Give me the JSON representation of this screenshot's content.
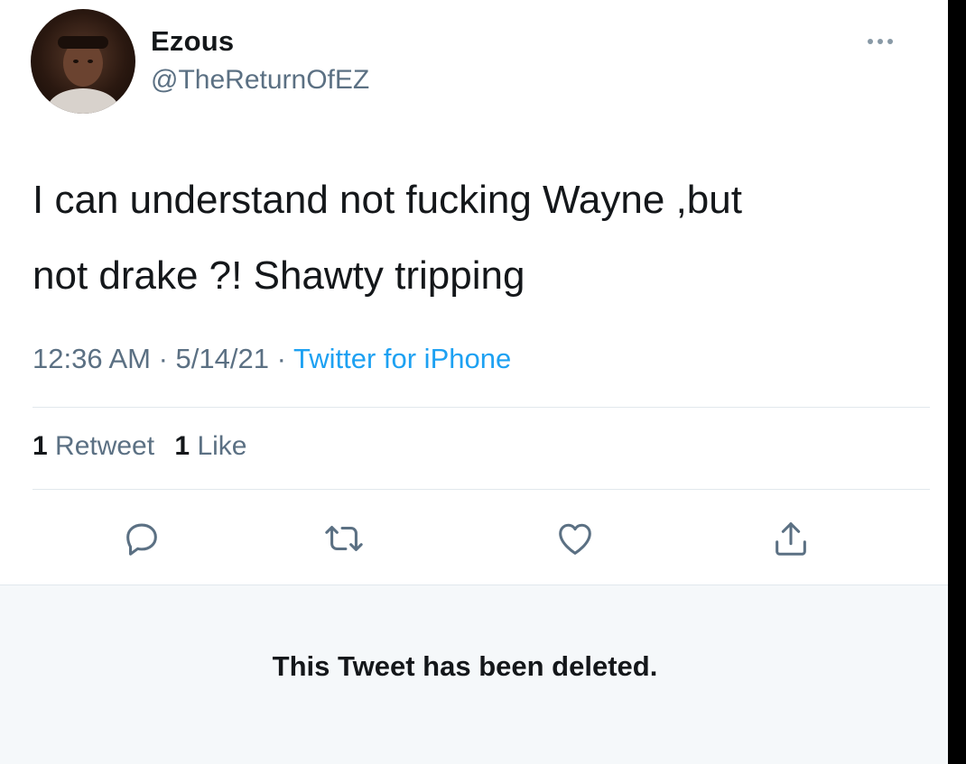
{
  "tweet": {
    "display_name": "Ezous",
    "handle": "@TheReturnOfEZ",
    "text_lines": [
      "I can understand not fucking Wayne ,but",
      "not drake ?! Shawty tripping"
    ],
    "time": "12:36 AM",
    "separator": " · ",
    "date": "5/14/21",
    "source": "Twitter for iPhone",
    "retweet_count": "1",
    "retweet_label": " Retweet",
    "like_count": "1",
    "like_label": " Like"
  },
  "quoted": {
    "deleted_message": "This Tweet has been deleted."
  },
  "icons": {
    "more": "more-icon",
    "reply": "reply-icon",
    "retweet": "retweet-icon",
    "like": "heart-icon",
    "share": "share-icon"
  },
  "colors": {
    "text": "#14171a",
    "secondary": "#5b7083",
    "link": "#1da1f2",
    "divider": "#e1e8ed",
    "deleted_bg": "#f5f8fa"
  }
}
